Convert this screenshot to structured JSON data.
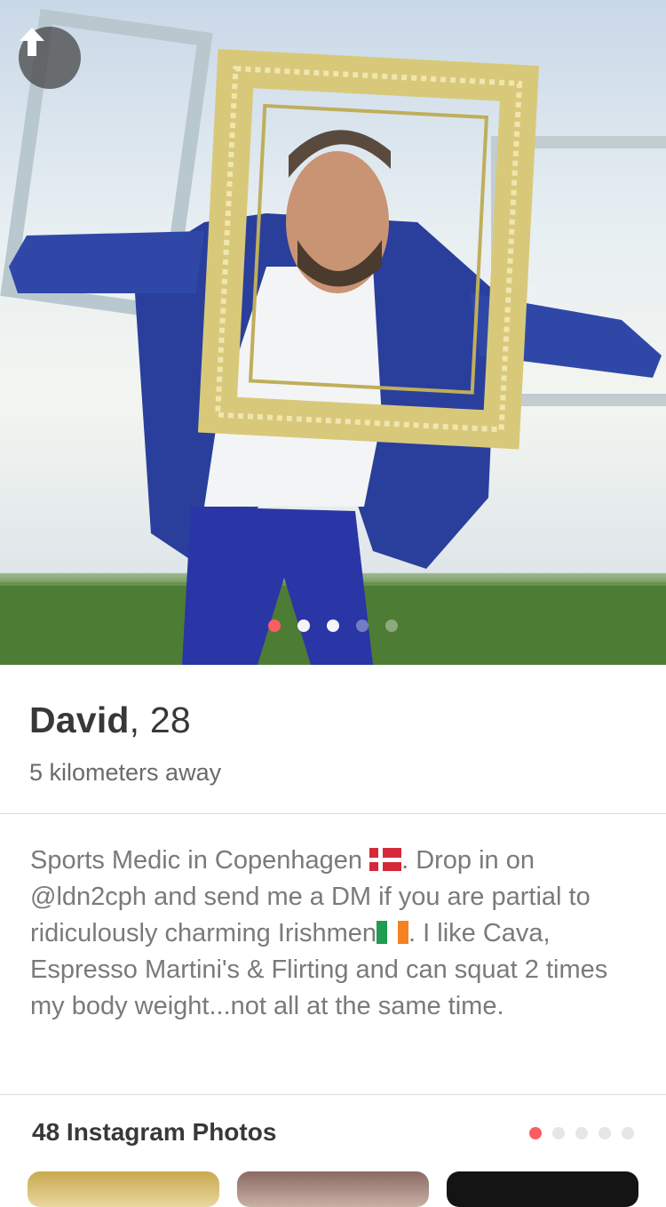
{
  "photo": {
    "description_icon": "arrow-up-icon",
    "page_count": 5,
    "current_page": 1
  },
  "profile": {
    "name": "David",
    "age_separator": ",",
    "age": "28",
    "distance": "5 kilometers away"
  },
  "bio": {
    "part1": "Sports Medic in Copenhagen ",
    "flag1": "denmark-flag-icon",
    "part2": ". Drop in on @ldn2cph and send me a DM if you are partial to ridiculously charming Irishmen",
    "flag2": "ireland-flag-icon",
    "part3": ". I like Cava, Espresso Martini's & Flirting and can squat 2 times my body weight...not all at the same time."
  },
  "instagram": {
    "title": "48 Instagram Photos",
    "page_count": 5,
    "current_page": 1
  },
  "colors": {
    "accent": "#fd5c63",
    "text_dark": "#383838",
    "text_muted": "#7a7a7a"
  }
}
